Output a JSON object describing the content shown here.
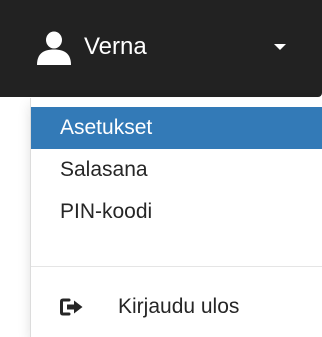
{
  "user_menu": {
    "username": "Verna",
    "icons": {
      "user": "user-icon",
      "caret": "caret-down-icon"
    },
    "colors": {
      "toggle_background": "#222222",
      "active_item_background": "#337ab7",
      "active_item_text": "#ffffff",
      "item_text": "#262626"
    }
  },
  "dropdown": {
    "items": [
      {
        "label": "Asetukset",
        "active": true
      },
      {
        "label": "Salasana",
        "active": false
      },
      {
        "label": "PIN-koodi",
        "active": false
      }
    ],
    "logout": {
      "label": "Kirjaudu ulos",
      "icon": "logout-icon"
    }
  }
}
